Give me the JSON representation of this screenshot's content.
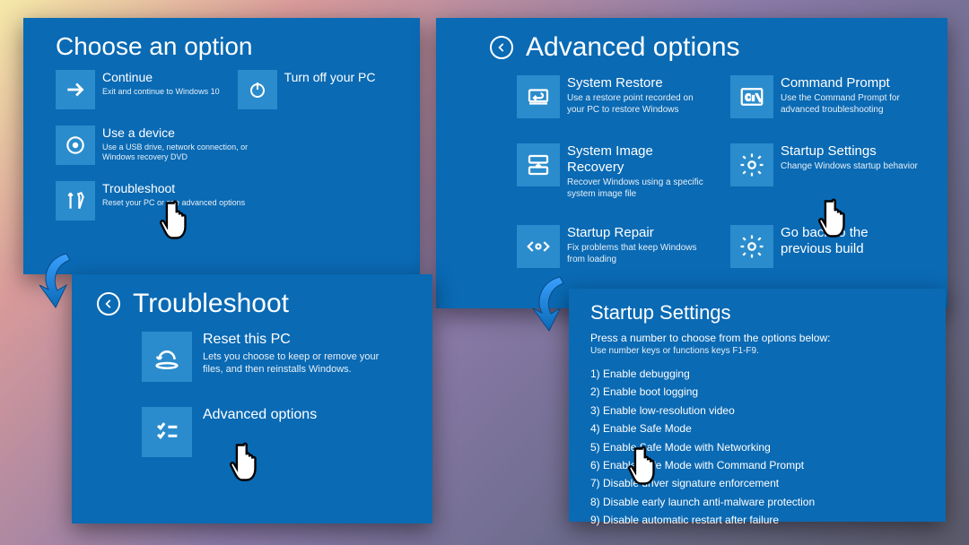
{
  "choose": {
    "title": "Choose an option",
    "continue": {
      "title": "Continue",
      "desc": "Exit and continue to Windows 10"
    },
    "turnoff": {
      "title": "Turn off your PC"
    },
    "device": {
      "title": "Use a device",
      "desc": "Use a USB drive, network connection, or Windows recovery DVD"
    },
    "trouble": {
      "title": "Troubleshoot",
      "desc": "Reset your PC or see advanced options"
    }
  },
  "troubleshoot": {
    "title": "Troubleshoot",
    "reset": {
      "title": "Reset this PC",
      "desc": "Lets you choose to keep or remove your files, and then reinstalls Windows."
    },
    "advanced": {
      "title": "Advanced options"
    }
  },
  "advanced": {
    "title": "Advanced options",
    "restore": {
      "title": "System Restore",
      "desc": "Use a restore point recorded on your PC to restore Windows"
    },
    "cmd": {
      "title": "Command Prompt",
      "desc": "Use the Command Prompt for advanced troubleshooting"
    },
    "image": {
      "title": "System Image Recovery",
      "desc": "Recover Windows using a specific system image file"
    },
    "startup": {
      "title": "Startup Settings",
      "desc": "Change Windows startup behavior"
    },
    "repair": {
      "title": "Startup Repair",
      "desc": "Fix problems that keep Windows from loading"
    },
    "goback": {
      "title": "Go back to the previous build"
    }
  },
  "startup": {
    "title": "Startup Settings",
    "sub1": "Press a number to choose from the options below:",
    "sub2": "Use number keys or functions keys F1-F9.",
    "i1": "1) Enable debugging",
    "i2": "2) Enable boot logging",
    "i3": "3) Enable low-resolution video",
    "i4": "4) Enable Safe Mode",
    "i5": "5) Enable Safe Mode with Networking",
    "i6": "6) Enable Safe Mode with Command Prompt",
    "i7": "7) Disable driver signature enforcement",
    "i8": "8) Disable early launch anti-malware protection",
    "i9": "9) Disable automatic restart after failure"
  }
}
